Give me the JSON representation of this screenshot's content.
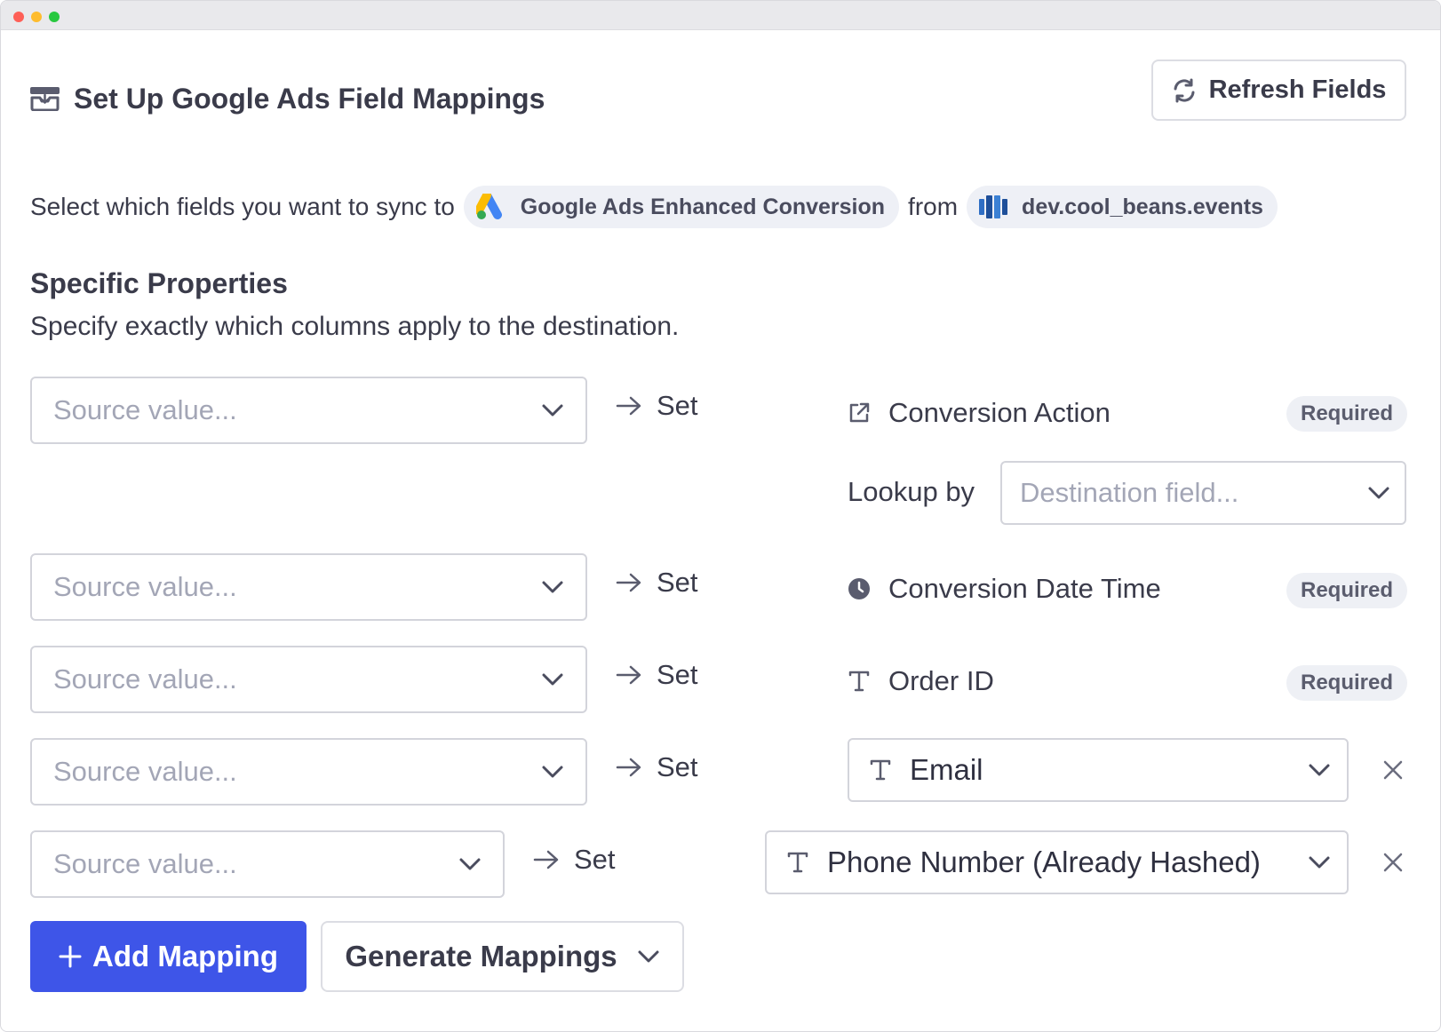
{
  "header": {
    "title": "Set Up Google Ads Field Mappings",
    "refresh_label": "Refresh Fields"
  },
  "sync": {
    "prefix": "Select which fields you want to sync to",
    "destination": "Google Ads Enhanced Conversion",
    "middle": "from",
    "source": "dev.cool_beans.events"
  },
  "section": {
    "title": "Specific Properties",
    "subtitle": "Specify exactly which columns apply to the destination."
  },
  "mapping": {
    "source_placeholder": "Source value...",
    "set_label": "Set",
    "required_label": "Required",
    "lookup_label": "Lookup by",
    "destination_placeholder": "Destination field..."
  },
  "rows": [
    {
      "field": "Conversion Action",
      "icon": "external-link-icon",
      "required": true
    },
    {
      "field": "Conversion Date Time",
      "icon": "clock-icon",
      "required": true
    },
    {
      "field": "Order ID",
      "icon": "text-type-icon",
      "required": true
    },
    {
      "field": "Email",
      "icon": "text-type-icon",
      "required": false,
      "removable": true
    },
    {
      "field": "Phone Number (Already Hashed)",
      "icon": "text-type-icon",
      "required": false,
      "removable": true
    }
  ],
  "actions": {
    "add_label": "Add Mapping",
    "generate_label": "Generate Mappings"
  },
  "colors": {
    "primary": "#3e55e8",
    "text": "#3a3b4a",
    "placeholder": "#a3a6b6",
    "border": "#d3d4db",
    "badge_bg": "#eef0f5"
  }
}
